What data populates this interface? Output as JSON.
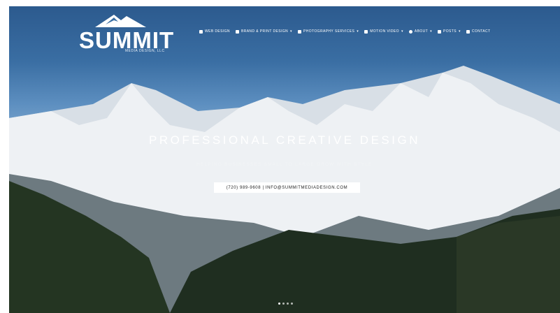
{
  "brand": {
    "name": "SUMMIT",
    "tagline": "MEDIA DESIGN, LLC"
  },
  "nav": [
    {
      "label": "Web Design",
      "icon": "monitor-icon"
    },
    {
      "label": "Brand & Print Design",
      "icon": "pen-icon",
      "dropdown": true
    },
    {
      "label": "Photography Services",
      "icon": "camera-icon",
      "dropdown": true
    },
    {
      "label": "Motion Video",
      "icon": "video-icon",
      "dropdown": true
    },
    {
      "label": "About",
      "icon": "info-icon",
      "dropdown": true
    },
    {
      "label": "Posts",
      "icon": "document-icon",
      "dropdown": true
    },
    {
      "label": "Contact",
      "icon": "envelope-icon"
    }
  ],
  "hero": {
    "headline": "PROFESSIONAL CREATIVE DESIGN",
    "subheadline": "HELPING BUSINESSES SMALL TO LARGE GROW WITH STYLE",
    "cta": "(720) 989-9608 | INFO@SUMMITMEDIADESIGN.COM"
  },
  "slider": {
    "count": 4,
    "active": 1
  },
  "colors": {
    "sky": "#3a6ea3",
    "text": "#ffffff",
    "button_bg": "#ffffff"
  }
}
